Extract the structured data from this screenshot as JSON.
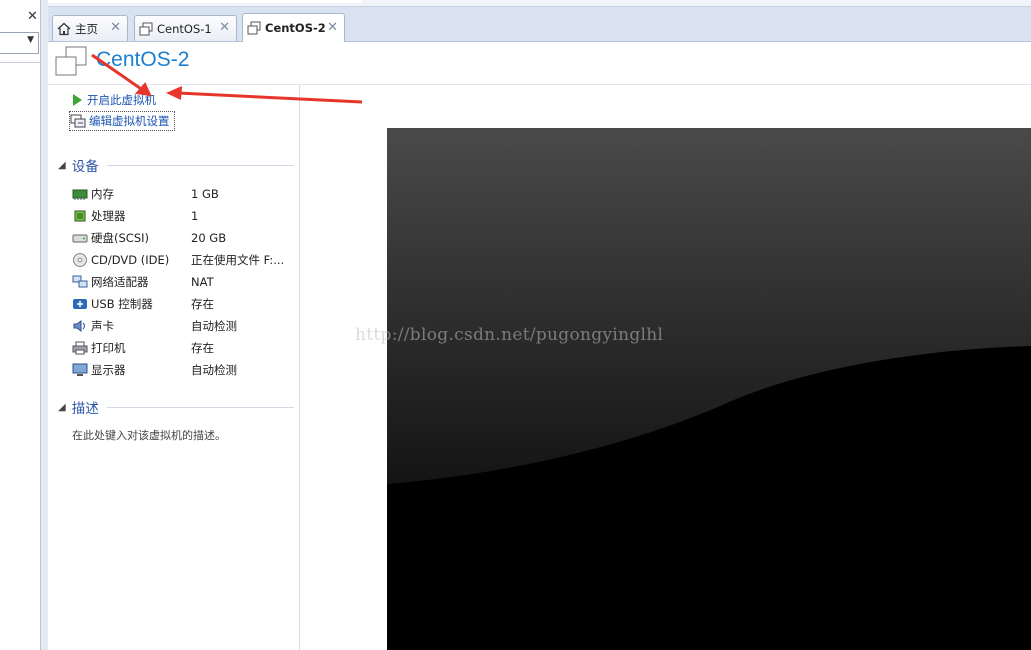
{
  "tabs": [
    {
      "label": "主页",
      "icon": "home-icon",
      "active": false
    },
    {
      "label": "CentOS-1",
      "icon": "vm-icon",
      "active": false
    },
    {
      "label": "CentOS-2",
      "icon": "vm-icon",
      "active": true
    }
  ],
  "vm": {
    "title": "CentOS-2"
  },
  "commands": {
    "power_on": "开启此虚拟机",
    "edit_settings": "编辑虚拟机设置"
  },
  "devices": {
    "title": "设备",
    "items": [
      {
        "name": "内存",
        "value": "1 GB",
        "icon": "memory-icon"
      },
      {
        "name": "处理器",
        "value": "1",
        "icon": "processor-icon"
      },
      {
        "name": "硬盘(SCSI)",
        "value": "20 GB",
        "icon": "hard-disk-icon"
      },
      {
        "name": "CD/DVD (IDE)",
        "value": "正在使用文件 F:...",
        "icon": "cd-dvd-icon"
      },
      {
        "name": "网络适配器",
        "value": "NAT",
        "icon": "network-adapter-icon"
      },
      {
        "name": "USB 控制器",
        "value": "存在",
        "icon": "usb-icon"
      },
      {
        "name": "声卡",
        "value": "自动检测",
        "icon": "sound-card-icon"
      },
      {
        "name": "打印机",
        "value": "存在",
        "icon": "printer-icon"
      },
      {
        "name": "显示器",
        "value": "自动检测",
        "icon": "display-icon"
      }
    ]
  },
  "description": {
    "title": "描述",
    "placeholder": "在此处键入对该虚拟机的描述。"
  },
  "watermark": "http://blog.csdn.net/pugongyinglhl",
  "colors": {
    "accent": "#1b7fd1",
    "link": "#1c56b3",
    "annotation": "#e8352b"
  }
}
